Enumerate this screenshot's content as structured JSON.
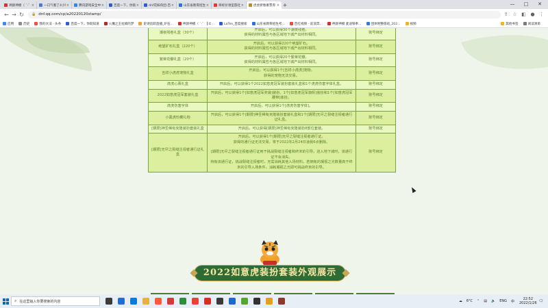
{
  "browser": {
    "tabs": [
      {
        "title": "神颜神模（ `-゛ ｀┃ㄜ 平岁一",
        "color": "#c33",
        "active": false
      },
      {
        "title": "一口气看了4小时！超级爆发，拍摄故事",
        "color": "#4a7ad8",
        "active": false
      },
      {
        "title": "腾讯游戏安全中心 - 腾讯游戏",
        "color": "#2e88e6",
        "active": false
      },
      {
        "title": "百度一下，你就知道",
        "color": "#2f5bd3",
        "active": false
      },
      {
        "title": "dnf花嫁舟团-百度知道-运营组",
        "color": "#2f5bd3",
        "active": false
      },
      {
        "title": "山东省教育招生考试院",
        "color": "#2d6fdc",
        "active": false
      },
      {
        "title": "目标价领型旅社-通过系统检查",
        "color": "#e33",
        "active": false
      },
      {
        "title": "虎虎新春奢票券 - DNF官网-腾讯",
        "color": "#b88a2d",
        "active": true
      }
    ],
    "new_tab_label": "+",
    "window_controls": [
      "—",
      "□",
      "✕"
    ],
    "url": "dnf.qq.com/cp/a20220120stamp/",
    "lock_icon": "lock-icon",
    "bookmarks": [
      {
        "label": "应用",
        "color": "#4285f4"
      },
      {
        "label": "历史",
        "color": "#8c8c8c"
      },
      {
        "label": "我的大法 · 头条",
        "color": "#f04e4e"
      },
      {
        "label": "百度一下，你就知道",
        "color": "#2f5bd3"
      },
      {
        "label": "火魔之王拉姆的梦",
        "color": "#b3272d"
      },
      {
        "label": "史诗追踪直播_炉石...",
        "color": "#e8a23a"
      },
      {
        "label": "神颜神模（ `-゛ ┃ㄜ...",
        "color": "#c33"
      },
      {
        "label": "LaTex_百度搜索",
        "color": "#2f5bd3"
      },
      {
        "label": "山东省教育招生考...",
        "color": "#2d6fdc"
      },
      {
        "label": "百红视频 - 前浪奔...",
        "color": "#e74c3c"
      },
      {
        "label": "神颜神模 麦迪铁奉...",
        "color": "#c33"
      },
      {
        "label": "团体附整值班_202...",
        "color": "#3a7bd5"
      },
      {
        "label": "视频",
        "color": "#f0b429"
      }
    ],
    "bookmarks_right": [
      "其他书签",
      "阅读清单"
    ]
  },
  "rewards_table": {
    "rows": [
      {
        "name": "潮夜残卷礼盒（30个）",
        "description": "开启后，可以获得30个潮夜残卷。\n获得的材料属性与各区域地下城产出材料相同。",
        "binding": "账号绑定"
      },
      {
        "name": "绝望矿石礼盒（220个）",
        "description": "开启后，可以获得220个绝望矿石。\n获得的材料属性与各区域地下城产出材料相同。",
        "binding": "账号绑定"
      },
      {
        "name": "繁荣花瓣礼盒（20个）",
        "description": "开启后，可以获得20个繁荣花瓣。\n获得的材料属性与各区域地下城产出材料相同。",
        "binding": "账号绑定"
      },
      {
        "name": "吉祥小虎虎宠物礼盒",
        "description": "开启后，可以获得1个[吉祥小虎虎]宠物。\n获得的宠物无法交易。",
        "binding": "账号绑定"
      },
      {
        "name": "虎虎心票礼盒",
        "description": "开启后，可以获得1个2022如意虎冠军装扮套装礼盒和1个虎虎伤害字体礼盒。",
        "binding": "账号绑定"
      },
      {
        "name": "2022如意虎冠军套装礼盒",
        "description": "开启后，可以获得1个[如意虎冠军奖袋]装扮、1个[如意虎冠军旗帜]装扮和1个[如意虎冠军腰带]装扮。",
        "binding": "账号绑定"
      },
      {
        "name": "虎虎伤害字体",
        "description": "开启后，可以获得1个[虎虎伤害字体]。",
        "binding": "账号绑定"
      },
      {
        "name": "小黑虎珍藏礼物",
        "description": "开启后，可以获得1个[期限]神圣稀有克隆装扮套装礼盒和1个[期限]无尽之裂缝注视者通行证礼盒。",
        "binding": "账号绑定"
      },
      {
        "name": "[期限]神圣稀有克隆装扮套装礼盒",
        "description": "开启后，可以获得[期限]神圣稀有克隆装扮8部位套装。",
        "binding": "账号绑定"
      },
      {
        "name": "[期限]无尽之裂缝注视者通行证礼盒",
        "description": "开启后，可以获得1个[期限]无尽之裂缝注视者通行证。\n获得的通行证无法交易，将于2022年2月24日凌晨6点删除。\n\n[期限]无尽之裂缝注视者通行证用于挑战裂缝注视者和终末的引导。进入地下城时，该通行证不会消失。\n持有该通行证，挑战裂缝注视者时，无需消耗其他入场材料。若拥有的凝视之光数量高于终末的引导入场条件，消耗凝视之光即可挑战终末的引导。",
        "binding": "账号绑定"
      }
    ]
  },
  "showcase": {
    "title": "2022如意虎装扮套装外观展示"
  },
  "taskbar": {
    "search_placeholder": "在这里输入你要搜索的内容",
    "apps": [
      "#3b3b3b",
      "#1f6fd1",
      "#0a7cd8",
      "#e5b33d",
      "#ff5a3c",
      "#d73838",
      "#2c8e3b",
      "#ea4335",
      "#d93025",
      "#3a3a3a",
      "#1b6ac9",
      "#55a630",
      "#323232",
      "#e4a11b",
      "#8a3b2a"
    ],
    "weather": "6°C",
    "ime": "ENG",
    "ime2": "中",
    "time": "22:52",
    "date": "2022/1/26"
  }
}
